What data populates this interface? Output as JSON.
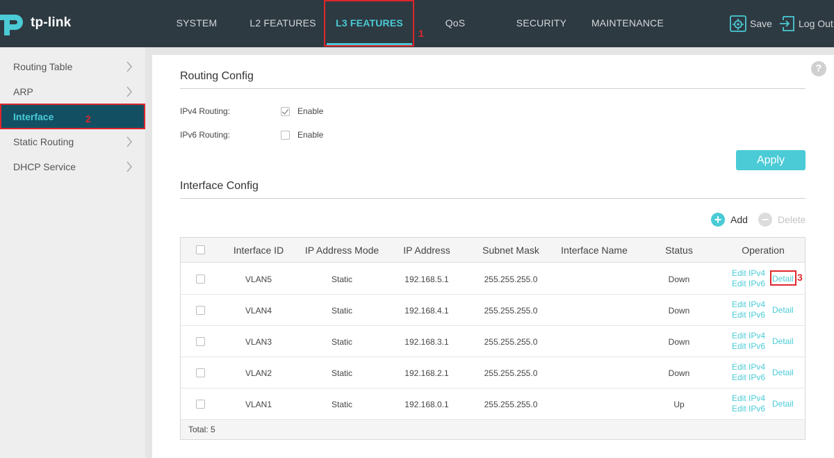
{
  "brand": {
    "logo_text": "tp-link"
  },
  "nav": {
    "items": [
      {
        "label": "SYSTEM"
      },
      {
        "label": "L2 FEATURES"
      },
      {
        "label": "L3 FEATURES"
      },
      {
        "label": "QoS"
      },
      {
        "label": "SECURITY"
      },
      {
        "label": "MAINTENANCE"
      }
    ],
    "active": "L3 FEATURES",
    "save_label": "Save",
    "logout_label": "Log Out"
  },
  "annotations": {
    "n1": "1",
    "n2": "2",
    "n3": "3"
  },
  "sidebar": {
    "items": [
      {
        "label": "Routing Table"
      },
      {
        "label": "ARP"
      },
      {
        "label": "Interface"
      },
      {
        "label": "Static Routing"
      },
      {
        "label": "DHCP Service"
      }
    ],
    "active": "Interface"
  },
  "routing_config": {
    "title": "Routing Config",
    "ipv4_label": "IPv4 Routing:",
    "ipv4_enable_label": "Enable",
    "ipv4_enabled": true,
    "ipv6_label": "IPv6 Routing:",
    "ipv6_enable_label": "Enable",
    "ipv6_enabled": false,
    "apply_label": "Apply"
  },
  "interface_config": {
    "title": "Interface Config",
    "add_label": "Add",
    "delete_label": "Delete",
    "columns": [
      "Interface ID",
      "IP Address Mode",
      "IP Address",
      "Subnet Mask",
      "Interface Name",
      "Status",
      "Operation"
    ],
    "rows": [
      {
        "id": "VLAN5",
        "mode": "Static",
        "ip": "192.168.5.1",
        "mask": "255.255.255.0",
        "name": "",
        "status": "Down"
      },
      {
        "id": "VLAN4",
        "mode": "Static",
        "ip": "192.168.4.1",
        "mask": "255.255.255.0",
        "name": "",
        "status": "Down"
      },
      {
        "id": "VLAN3",
        "mode": "Static",
        "ip": "192.168.3.1",
        "mask": "255.255.255.0",
        "name": "",
        "status": "Down"
      },
      {
        "id": "VLAN2",
        "mode": "Static",
        "ip": "192.168.2.1",
        "mask": "255.255.255.0",
        "name": "",
        "status": "Down"
      },
      {
        "id": "VLAN1",
        "mode": "Static",
        "ip": "192.168.0.1",
        "mask": "255.255.255.0",
        "name": "",
        "status": "Up"
      }
    ],
    "op_edit_ipv4": "Edit IPv4",
    "op_edit_ipv6": "Edit IPv6",
    "op_detail": "Detail",
    "total_label": "Total: 5"
  },
  "colors": {
    "accent": "#4acbd6",
    "topbar": "#2e3a42",
    "sidebar_active": "#124f63",
    "annotation": "#e0262c"
  }
}
